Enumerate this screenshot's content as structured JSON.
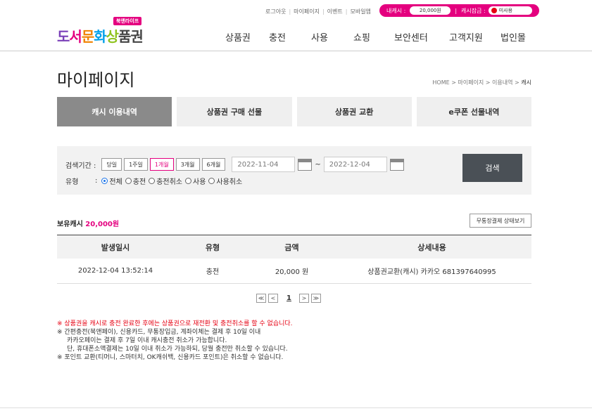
{
  "util_links": [
    "로그아웃",
    "마이페이지",
    "이벤트",
    "모바일앱"
  ],
  "cash_bar": {
    "cash_label": "내캐시 :",
    "cash_value": "20,000원",
    "lock_label": "캐시잠금 :",
    "lock_value": "미사용",
    "accent": "#e4007f"
  },
  "logo": {
    "badge": "북앤라이프",
    "word_parts": [
      "도",
      "서",
      "문",
      "화",
      "상",
      "품권"
    ]
  },
  "gnb": [
    "상품권",
    "충전",
    "사용",
    "쇼핑",
    "보안센터",
    "고객지원",
    "법인몰"
  ],
  "page_title": "마이페이지",
  "breadcrumb": {
    "path": "HOME > 마이페이지 > 이용내역 > ",
    "current": "캐시"
  },
  "tabs": [
    "캐시 이용내역",
    "상품권 구매 선물",
    "상품권 교환",
    "e쿠폰 선물내역"
  ],
  "search": {
    "period_label": "검색기간 :",
    "periods": [
      "당일",
      "1주일",
      "1개월",
      "3개월",
      "6개월"
    ],
    "active_period": "1개월",
    "date_from": "2022-11-04",
    "date_sep": "~",
    "date_to": "2022-12-04",
    "type_label": "유형",
    "type_colon": ":",
    "types": [
      "전체",
      "충전",
      "충전취소",
      "사용",
      "사용취소"
    ],
    "selected_type": "전체",
    "button": "검색"
  },
  "holding": {
    "label": "보유캐시",
    "amount": "20,000원"
  },
  "status_button": "무통장결제 상태보기",
  "table": {
    "headers": [
      "발생일시",
      "유형",
      "금액",
      "상세내용"
    ],
    "rows": [
      [
        "2022-12-04 13:52:14",
        "충전",
        "20,000 원",
        "상품권교환(캐시) 카카오 681397640995"
      ]
    ]
  },
  "pager": {
    "first": "≪",
    "prev": "<",
    "current": "1",
    "next": ">",
    "last": "≫"
  },
  "notes": [
    "※ 상품권을 캐시로 충전 완료한 후에는 상품권으로 재전환 및 충전취소를 할 수 없습니다.",
    "※ 간편충전(북앤페이), 신용카드, 무통장입금, 계좌이체는 결제 후 10일 이내",
    "카카오페이는 결제 후 7일 이내 캐시충전 취소가 가능합니다.",
    "단, 휴대폰소액결제는 10일 이내 취소가 가능하되, 당월 충전만 취소할 수 있습니다.",
    "※ 포인트 교환(티머니, 스마터치, OK캐쉬백, 신용카드 포인트)은 취소할 수 없습니다."
  ]
}
